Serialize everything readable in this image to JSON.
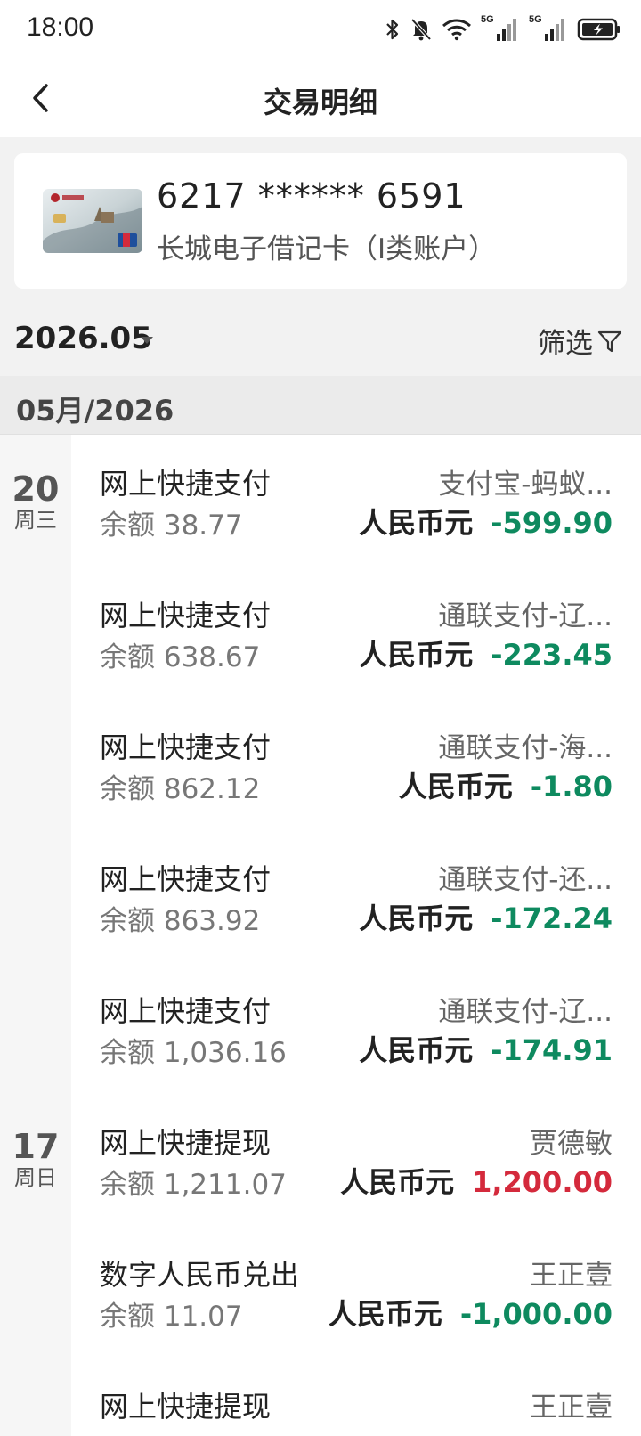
{
  "status_bar": {
    "time": "18:00",
    "icons": [
      "bluetooth-icon",
      "mute-icon",
      "wifi-icon",
      "signal-5g-icon",
      "signal-5g-icon",
      "battery-charging-icon"
    ],
    "signal_label": "5G"
  },
  "nav": {
    "title": "交易明细",
    "back_icon": "chevron-left-icon"
  },
  "card": {
    "number": "6217 ****** 6591",
    "name": "长城电子借记卡（I类账户）"
  },
  "filter_bar": {
    "month": "2026.05",
    "filter_label": "筛选",
    "filter_icon": "funnel-icon"
  },
  "section": {
    "header": "05月/2026"
  },
  "date_groups": [
    {
      "day": "20",
      "weekday": "周三"
    },
    {
      "day": "17",
      "weekday": "周日"
    }
  ],
  "transactions": [
    {
      "type": "网上快捷支付",
      "balance": "余额 38.77",
      "counterparty": "支付宝-蚂蚁...",
      "currency": "人民币元",
      "amount": "-599.90",
      "direction": "out"
    },
    {
      "type": "网上快捷支付",
      "balance": "余额 638.67",
      "counterparty": "通联支付-辽...",
      "currency": "人民币元",
      "amount": "-223.45",
      "direction": "out"
    },
    {
      "type": "网上快捷支付",
      "balance": "余额 862.12",
      "counterparty": "通联支付-海...",
      "currency": "人民币元",
      "amount": "-1.80",
      "direction": "out"
    },
    {
      "type": "网上快捷支付",
      "balance": "余额 863.92",
      "counterparty": "通联支付-还...",
      "currency": "人民币元",
      "amount": "-172.24",
      "direction": "out"
    },
    {
      "type": "网上快捷支付",
      "balance": "余额 1,036.16",
      "counterparty": "通联支付-辽...",
      "currency": "人民币元",
      "amount": "-174.91",
      "direction": "out"
    },
    {
      "type": "网上快捷提现",
      "balance": "余额 1,211.07",
      "counterparty": "贾德敏",
      "currency": "人民币元",
      "amount": "1,200.00",
      "direction": "in"
    },
    {
      "type": "数字人民币兑出",
      "balance": "余额 11.07",
      "counterparty": "王正壹",
      "currency": "人民币元",
      "amount": "-1,000.00",
      "direction": "out"
    },
    {
      "type": "网上快捷提现",
      "balance": "",
      "counterparty": "王正壹",
      "currency": "",
      "amount": "",
      "direction": "in"
    }
  ],
  "colors": {
    "outflow": "#0e8a5f",
    "inflow": "#d42a3c"
  }
}
